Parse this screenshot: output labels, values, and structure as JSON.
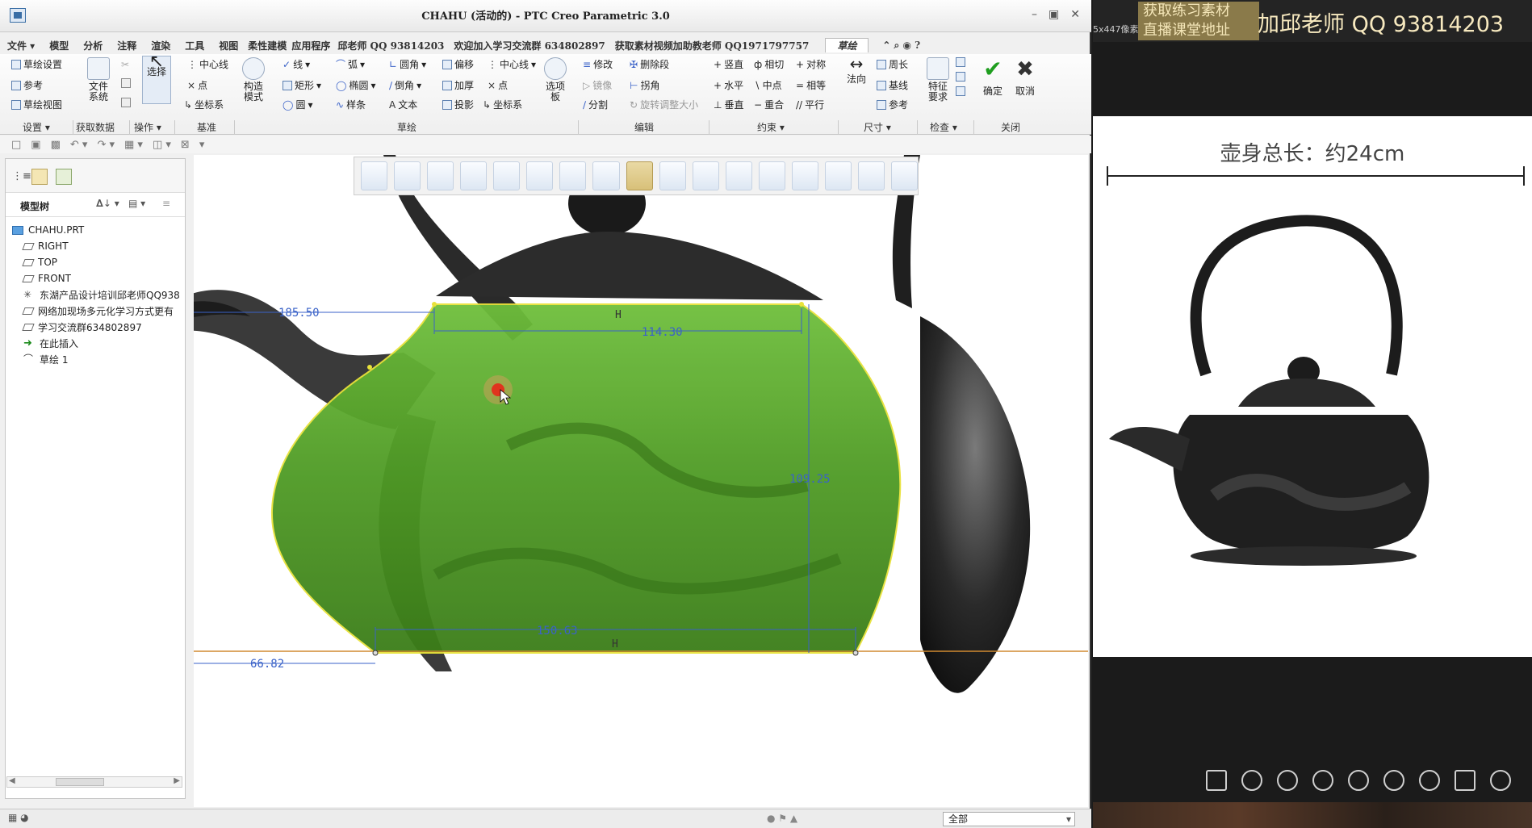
{
  "window": {
    "title": "CHAHU (活动的) - PTC Creo Parametric 3.0"
  },
  "menu": {
    "file": "文件 ▾",
    "items": [
      "模型",
      "分析",
      "注释",
      "渲染",
      "工具",
      "视图",
      "柔性建模",
      "应用程序",
      "邱老师 QQ 93814203",
      "欢迎加入学习交流群 634802897",
      "获取素材视频加助教老师 QQ1971797757"
    ],
    "active_tab": "草绘"
  },
  "ribbon": {
    "setup": {
      "sketch_setup": "草绘设置",
      "reference": "参考",
      "sketch_view": "草绘视图"
    },
    "get_data": {
      "file_system": "文件\n系统"
    },
    "operations": {
      "select": "选择"
    },
    "datum": {
      "centerline": "中心线",
      "point": "点",
      "csys": "坐标系"
    },
    "construct_mode": "构造\n模式",
    "sketch": {
      "line": "线",
      "arc": "弧",
      "circle": "圆",
      "rect": "矩形",
      "ellipse": "椭圆",
      "spline": "样条",
      "fillet": "圆角",
      "chamfer": "倒角",
      "text": "文本",
      "offset": "偏移",
      "thicken": "加厚",
      "project": "投影",
      "centerline": "中心线",
      "point": "点",
      "csys": "坐标系",
      "palette": "选项\n板"
    },
    "editing": {
      "modify": "修改",
      "delete_segment": "删除段",
      "mirror": "镜像",
      "corner": "拐角",
      "divide": "分割",
      "rotate_resize": "旋转调整大小"
    },
    "constrain": {
      "vertical": "竖直",
      "tangent": "相切",
      "symmetric": "对称",
      "horizontal": "水平",
      "midpoint": "中点",
      "equal": "相等",
      "perpendicular": "垂直",
      "coincident": "重合",
      "parallel": "平行"
    },
    "dimension": {
      "normal": "法向",
      "perimeter": "周长",
      "baseline": "基线",
      "reference": "参考"
    },
    "inspect": {
      "feature_req": "特征\n要求"
    },
    "close": {
      "ok": "确定",
      "cancel": "取消"
    },
    "groups": [
      "设置 ▾",
      "获取数据",
      "操作 ▾",
      "基准",
      "草绘",
      "编辑",
      "约束 ▾",
      "尺寸 ▾",
      "检查 ▾",
      "关闭"
    ]
  },
  "model_tree": {
    "header": "模型树",
    "items": [
      {
        "label": "CHAHU.PRT",
        "icon": "part-icon"
      },
      {
        "label": "RIGHT",
        "icon": "datum-plane-icon"
      },
      {
        "label": "TOP",
        "icon": "datum-plane-icon"
      },
      {
        "label": "FRONT",
        "icon": "datum-plane-icon"
      },
      {
        "label": "东湖产品设计培训邱老师QQ938",
        "icon": "csys-icon"
      },
      {
        "label": "网络加现场多元化学习方式更有",
        "icon": "datum-plane-icon"
      },
      {
        "label": "学习交流群634802897",
        "icon": "datum-plane-icon"
      },
      {
        "label": "在此插入",
        "icon": "insert-arrow-icon"
      },
      {
        "label": "草绘 1",
        "icon": "sketch-icon"
      }
    ]
  },
  "dimensions": {
    "left_top": "185.50",
    "top_width": "114.30",
    "height": "109.25",
    "bottom_width": "150.63",
    "left_bottom": "66.82",
    "constraint_h": "H"
  },
  "statusbar": {
    "filter": "全部"
  },
  "right_panel": {
    "banner_line1": "获取练习素材",
    "banner_line2": "直播课堂地址",
    "banner_qq": "加邱老师 QQ 93814203",
    "banner_small": "5x447像素",
    "caption": "壶身总长：约24cm"
  },
  "colors": {
    "sketch_fill": "#63b12d",
    "dimension": "#3a62c8",
    "sketch_edge": "#e8e23a",
    "confirm": "#1f9e1f"
  }
}
